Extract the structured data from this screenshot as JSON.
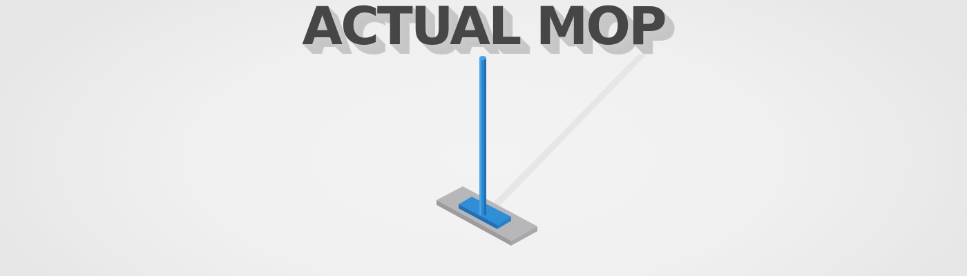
{
  "title": "ACTUAL MOP",
  "illustration": {
    "icon": "mop-icon",
    "colors": {
      "handle": "#2a86cf",
      "handle_dark": "#1f6fae",
      "handle_light": "#4aa3e4",
      "pad": "#2f8ed6",
      "base_top": "#b5b5b7",
      "base_side": "#9a9a9c",
      "shadow": "#d9d9db"
    }
  }
}
